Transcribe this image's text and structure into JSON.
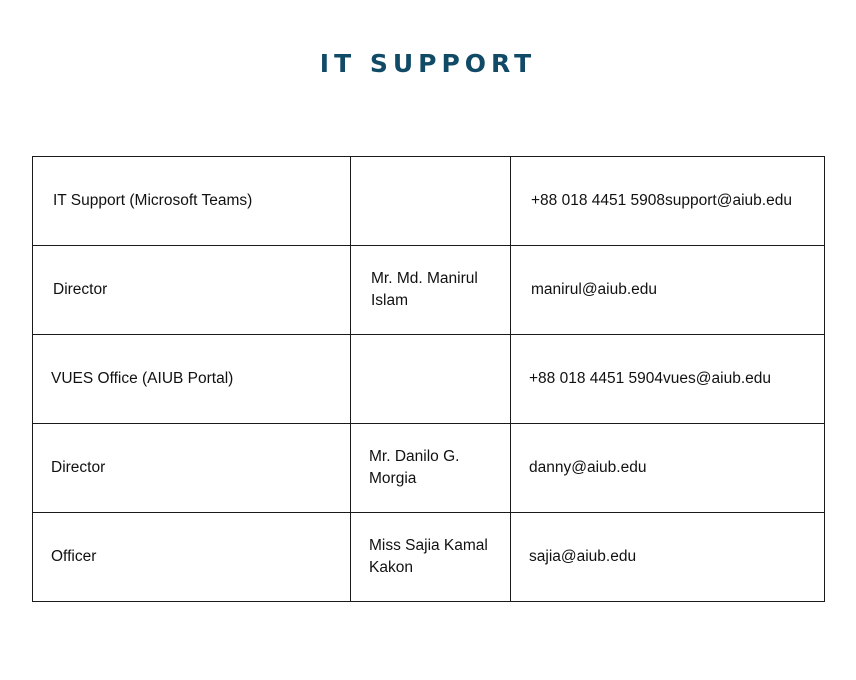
{
  "title": "IT SUPPORT",
  "rows": [
    {
      "role": "IT Support (Microsoft Teams)",
      "name": "",
      "contact": "+88 018 4451 5908support@aiub.edu"
    },
    {
      "role": "Director",
      "name": "Mr. Md. Manirul Islam",
      "contact": "manirul@aiub.edu"
    },
    {
      "role": "VUES Office (AIUB Portal)",
      "name": "",
      "contact": "+88 018 4451 5904vues@aiub.edu"
    },
    {
      "role": "Director",
      "name": "Mr. Danilo G. Morgia",
      "contact": "danny@aiub.edu"
    },
    {
      "role": "Officer",
      "name": "Miss Sajia Kamal Kakon",
      "contact": "sajia@aiub.edu"
    }
  ]
}
